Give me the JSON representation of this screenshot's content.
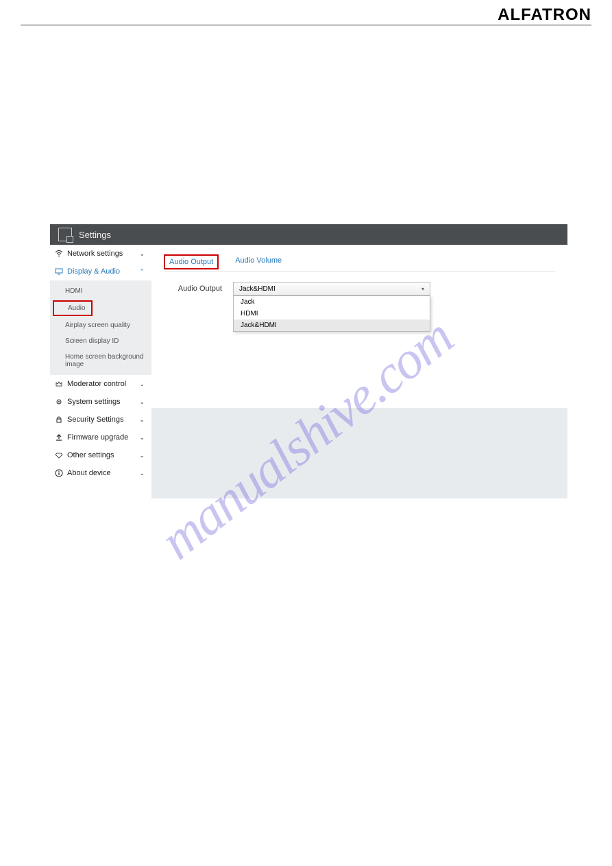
{
  "brand": "ALFATRON",
  "watermark": "manualshive.com",
  "header": {
    "title": "Settings"
  },
  "sidebar": {
    "items": [
      {
        "icon": "wifi",
        "label": "Network settings",
        "expanded": false
      },
      {
        "icon": "monitor",
        "label": "Display & Audio",
        "expanded": true,
        "active": true,
        "children": [
          {
            "label": "HDMI"
          },
          {
            "label": "Audio",
            "highlighted": true
          },
          {
            "label": "Airplay screen quality"
          },
          {
            "label": "Screen display ID"
          },
          {
            "label": "Home screen background image"
          }
        ]
      },
      {
        "icon": "crown",
        "label": "Moderator control",
        "expanded": false
      },
      {
        "icon": "gear",
        "label": "System settings",
        "expanded": false
      },
      {
        "icon": "lock",
        "label": "Security Settings",
        "expanded": false
      },
      {
        "icon": "upload",
        "label": "Firmware upgrade",
        "expanded": false
      },
      {
        "icon": "diamond",
        "label": "Other settings",
        "expanded": false
      },
      {
        "icon": "info",
        "label": "About device",
        "expanded": false
      }
    ]
  },
  "content": {
    "tabs": [
      {
        "label": "Audio Output",
        "active": true
      },
      {
        "label": "Audio Volume",
        "active": false
      }
    ],
    "form": {
      "label": "Audio Output",
      "selected": "Jack&HDMI",
      "options": [
        "Jack",
        "HDMI",
        "Jack&HDMI"
      ]
    }
  }
}
